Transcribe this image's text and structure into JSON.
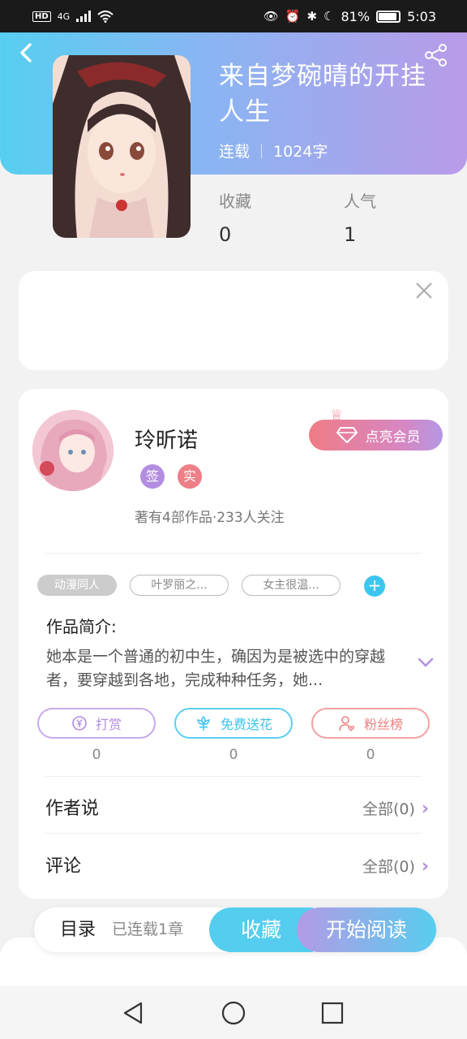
{
  "status_bar": {
    "hd": "HD",
    "network": "4G",
    "battery": "81%",
    "time": "5:03"
  },
  "book": {
    "title": "来自梦碗晴的开挂人生",
    "status": "连载",
    "word_count": "1024字",
    "favorites_label": "收藏",
    "favorites_value": "0",
    "popularity_label": "人气",
    "popularity_value": "1"
  },
  "author": {
    "name": "玲昕诺",
    "badge_sign": "签",
    "badge_real": "实",
    "stats": "著有4部作品·233人关注",
    "vip_label": "点亮会员"
  },
  "tags": [
    "动漫同人",
    "叶罗丽之...",
    "女主很温..."
  ],
  "intro": {
    "title": "作品简介:",
    "text": "她本是一个普通的初中生，确因为是被选中的穿越者，要穿越到各地，完成种种任务，她..."
  },
  "actions": [
    {
      "label": "打赏",
      "count": "0",
      "color": "#b38ee0"
    },
    {
      "label": "免费送花",
      "count": "0",
      "color": "#3cc6ef"
    },
    {
      "label": "粉丝榜",
      "count": "0",
      "color": "#f08080"
    }
  ],
  "rows": {
    "author_says_label": "作者说",
    "author_says_value": "全部(0)",
    "comments_label": "评论",
    "comments_value": "全部(0)"
  },
  "bottom": {
    "toc_label": "目录",
    "toc_count": "已连载1章",
    "favorite_button": "收藏",
    "read_button": "开始阅读"
  }
}
